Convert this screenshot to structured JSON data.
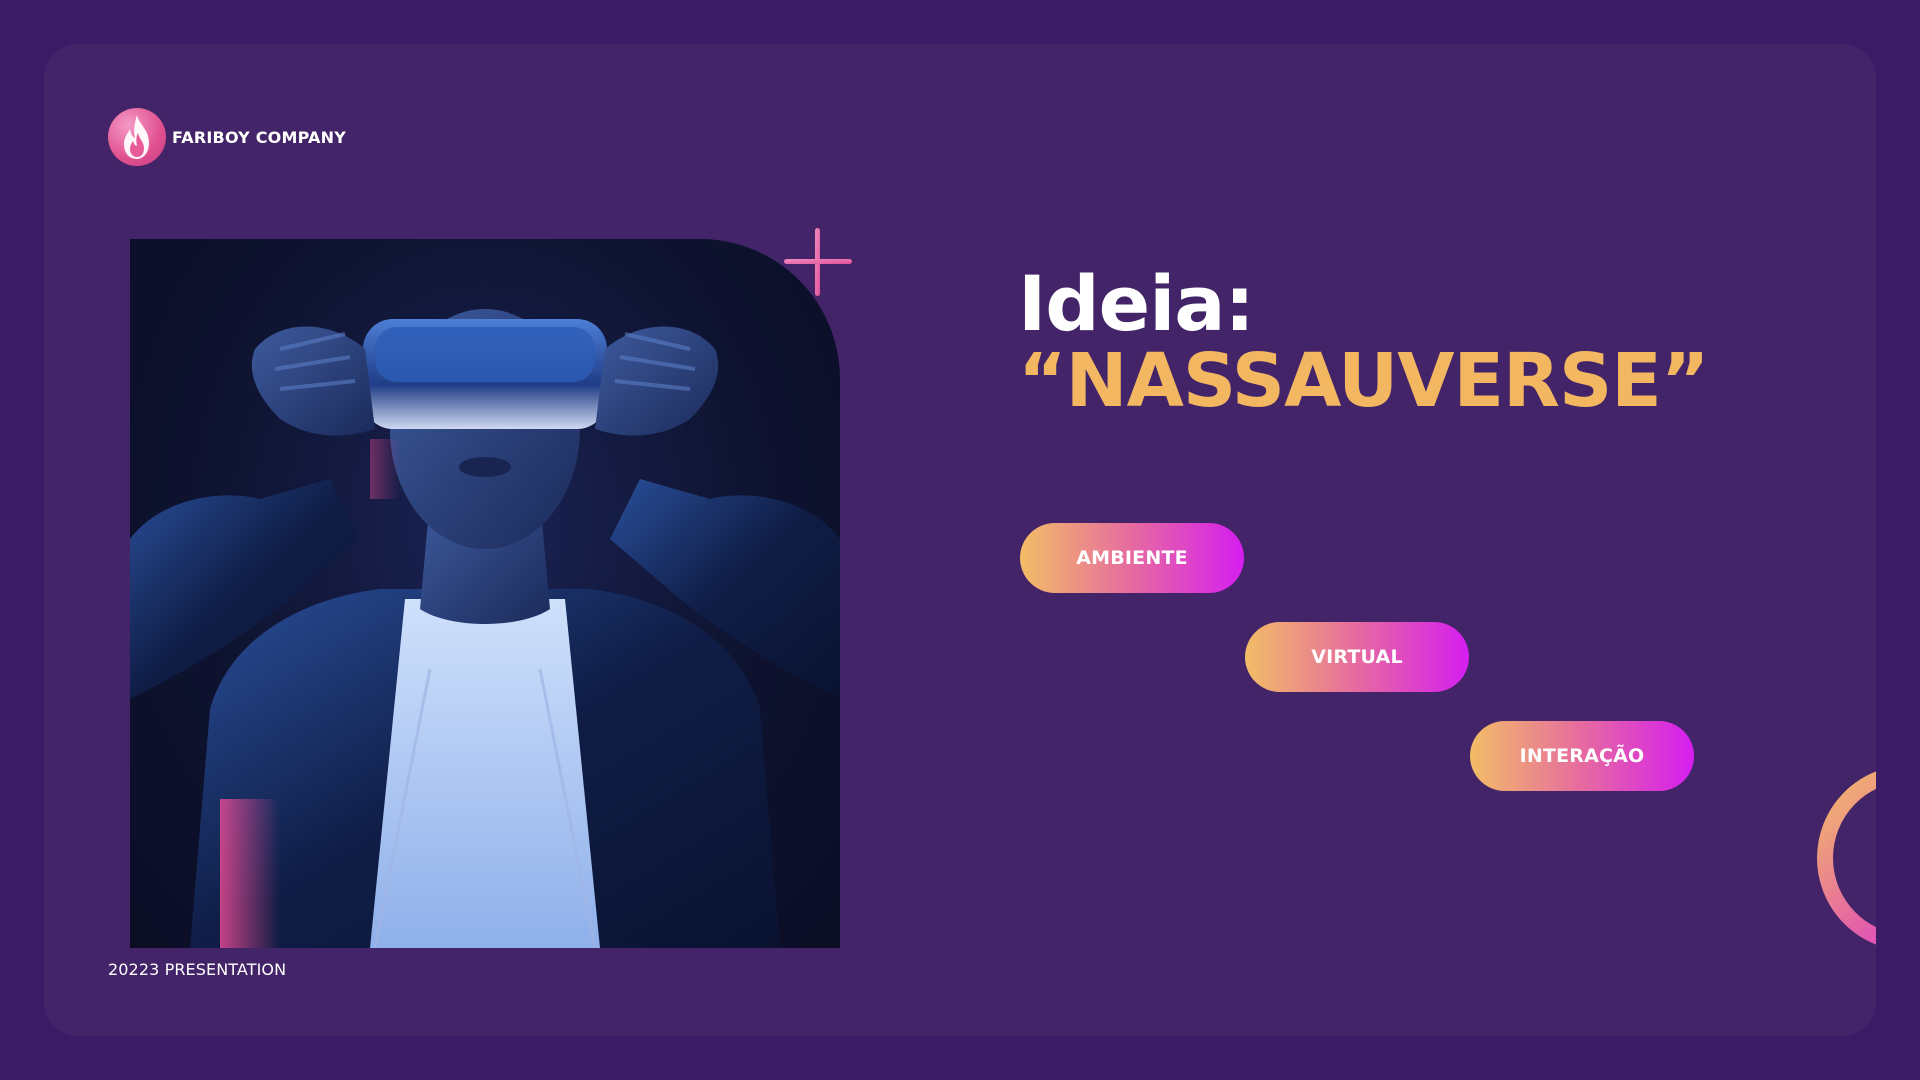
{
  "brand": {
    "name": "FARIBOY COMPANY",
    "logo_icon": "flame-icon"
  },
  "title": {
    "line1": "Ideia:",
    "line2": "“NASSAUVERSE”"
  },
  "tags": [
    {
      "label": "AMBIENTE"
    },
    {
      "label": "VIRTUAL"
    },
    {
      "label": "INTERAÇÃO"
    }
  ],
  "footer": {
    "text": "20223 PRESENTATION"
  },
  "decorations": {
    "plus_icon": "plus-icon",
    "ring_icon": "ring-icon",
    "photo": "vr-headset-person-photo"
  },
  "colors": {
    "background": "#3b1b66",
    "panel": "#432468",
    "accent_gold": "#f2b760",
    "gradient_start": "#f2bd66",
    "gradient_mid": "#e66aa0",
    "gradient_end": "#d51ef0",
    "text": "#ffffff"
  }
}
